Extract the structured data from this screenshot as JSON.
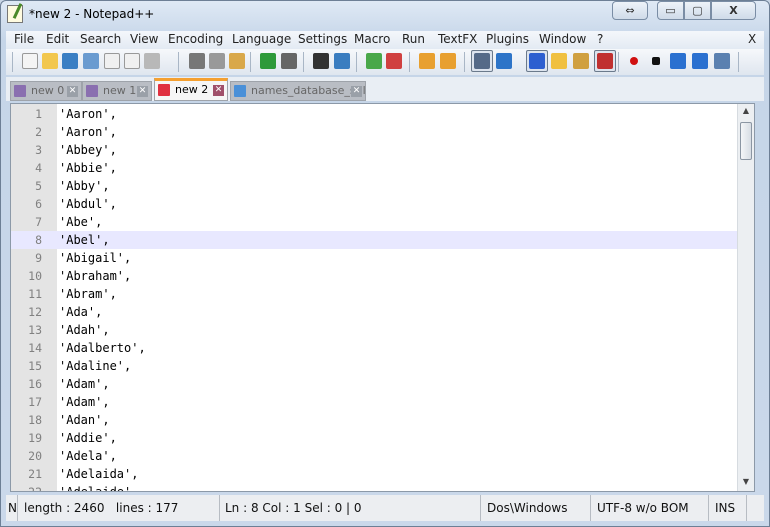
{
  "window": {
    "title": "*new  2 - Notepad++",
    "buttons": {
      "restore_layout": "⇔",
      "minimize": "▭",
      "maximize": "▢",
      "close": "X"
    }
  },
  "menu": {
    "items": [
      "File",
      "Edit",
      "Search",
      "View",
      "Encoding",
      "Language",
      "Settings",
      "Macro",
      "Run",
      "TextFX",
      "Plugins",
      "Window",
      "?"
    ],
    "close": "X"
  },
  "toolbar": {
    "icons": [
      "new-file",
      "open-file",
      "save",
      "save-all",
      "close",
      "close-all",
      "print",
      "cut",
      "copy",
      "paste",
      "undo",
      "redo",
      "find",
      "replace",
      "zoom-in",
      "zoom-out",
      "sync-vertical",
      "sync-horizontal",
      "word-wrap",
      "show-all-chars",
      "indent-guide",
      "user-language",
      "doc-map",
      "function-list",
      "record-macro",
      "stop-record",
      "play-macro",
      "run-macro-multiple",
      "save-macro"
    ]
  },
  "tabs": [
    {
      "label": "new  0",
      "active": false,
      "color": "#8a6fb0"
    },
    {
      "label": "new  1",
      "active": false,
      "color": "#8a6fb0"
    },
    {
      "label": "new  2",
      "active": true,
      "color": "#e03040"
    },
    {
      "label": "names_database_sql",
      "active": false,
      "color": "#4a90d8"
    }
  ],
  "editor": {
    "current_line": 8,
    "lines": [
      "'Aaron',",
      "'Aaron',",
      "'Abbey',",
      "'Abbie',",
      "'Abby',",
      "'Abdul',",
      "'Abe',",
      "'Abel',",
      "'Abigail',",
      "'Abraham',",
      "'Abram',",
      "'Ada',",
      "'Adah',",
      "'Adalberto',",
      "'Adaline',",
      "'Adam',",
      "'Adam',",
      "'Adan',",
      "'Addie',",
      "'Adela',",
      "'Adelaida',",
      "'Adelaide',"
    ]
  },
  "statusbar": {
    "type": "Normal text file",
    "length": "length : 2460",
    "lines": "lines : 177",
    "position": "Ln : 8    Col : 1    Sel : 0 | 0",
    "eol": "Dos\\Windows",
    "encoding": "UTF-8 w/o BOM",
    "mode": "INS"
  }
}
